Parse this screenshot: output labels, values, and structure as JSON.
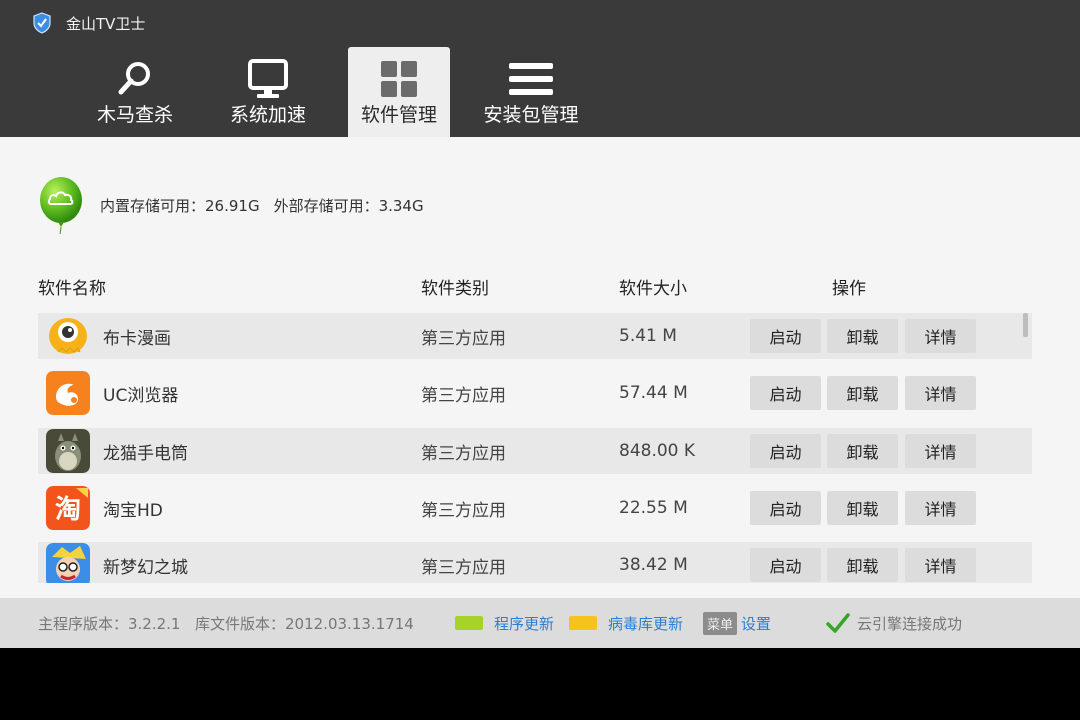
{
  "header": {
    "app_title": "金山TV卫士",
    "tabs": [
      {
        "label": "木马查杀",
        "icon": "magnifier-icon",
        "active": false
      },
      {
        "label": "系统加速",
        "icon": "monitor-icon",
        "active": false
      },
      {
        "label": "软件管理",
        "icon": "grid-icon",
        "active": true
      },
      {
        "label": "安装包管理",
        "icon": "list-icon",
        "active": false
      }
    ]
  },
  "storage": {
    "internal": "内置存储可用：26.91G",
    "external": "外部存储可用：3.34G"
  },
  "columns": {
    "name": "软件名称",
    "category": "软件类别",
    "size": "软件大小",
    "actions": "操作"
  },
  "apps": [
    {
      "name": "布卡漫画",
      "category": "第三方应用",
      "size": "5.41 M",
      "icon": "buka-icon"
    },
    {
      "name": "UC浏览器",
      "category": "第三方应用",
      "size": "57.44 M",
      "icon": "uc-browser-icon"
    },
    {
      "name": "龙猫手电筒",
      "category": "第三方应用",
      "size": "848.00 K",
      "icon": "totoro-icon"
    },
    {
      "name": "淘宝HD",
      "category": "第三方应用",
      "size": "22.55 M",
      "icon": "taobao-icon"
    },
    {
      "name": "新梦幻之城",
      "category": "第三方应用",
      "size": "38.42 M",
      "icon": "game-icon"
    }
  ],
  "buttons": {
    "launch": "启动",
    "uninstall": "卸载",
    "details": "详情"
  },
  "footer": {
    "main_version": "主程序版本：3.2.2.1",
    "lib_version": "库文件版本：2012.03.13.1714",
    "program_update": "程序更新",
    "virus_update": "病毒库更新",
    "menu_key": "菜单",
    "settings": "设置",
    "cloud_status": "云引擎连接成功"
  },
  "colors": {
    "header_bg": "#3a3a3a",
    "program_update_swatch": "#a6d22a",
    "virus_update_swatch": "#f6c21c",
    "link": "#2a7ed6"
  }
}
